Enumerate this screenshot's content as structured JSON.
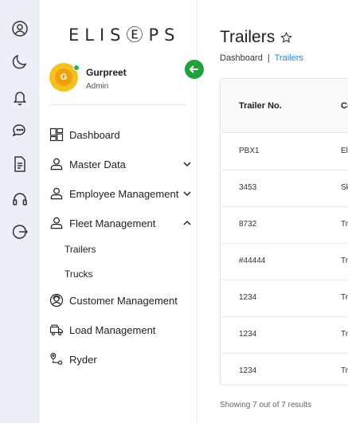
{
  "rail": {
    "icons": [
      "user-circle-icon",
      "moon-icon",
      "bell-icon",
      "chat-icon",
      "document-icon",
      "headset-icon",
      "logout-icon"
    ]
  },
  "sidebar": {
    "logo_text": "ELISⒺPS",
    "user": {
      "initial": "G",
      "name": "Gurpreet",
      "role": "Admin"
    },
    "items": [
      {
        "label": "Dashboard",
        "icon": "dashboard-icon"
      },
      {
        "label": "Master Data",
        "icon": "user-icon",
        "expanded": false
      },
      {
        "label": "Employee Management",
        "icon": "user-icon",
        "expanded": false
      },
      {
        "label": "Fleet Management",
        "icon": "user-icon",
        "expanded": true
      },
      {
        "label": "Customer Management",
        "icon": "customer-service-icon"
      },
      {
        "label": "Load Management",
        "icon": "truck-icon"
      },
      {
        "label": "Ryder",
        "icon": "route-icon"
      }
    ],
    "fleet_sub_items": [
      {
        "label": "Trailers"
      },
      {
        "label": "Trucks"
      }
    ]
  },
  "header": {
    "title": "Trailers",
    "breadcrumb": {
      "root": "Dashboard",
      "separator": "|",
      "current": "Trailers"
    }
  },
  "table": {
    "columns": [
      "Trailer No.",
      "Co"
    ],
    "rows": [
      {
        "trailer_no": "PBX1",
        "col2": "Ell"
      },
      {
        "trailer_no": "3453",
        "col2": "Sk"
      },
      {
        "trailer_no": "8732",
        "col2": "Tra"
      },
      {
        "trailer_no": "#44444",
        "col2": "Tra"
      },
      {
        "trailer_no": "1234",
        "col2": "Tra"
      },
      {
        "trailer_no": "1234",
        "col2": "Tra"
      },
      {
        "trailer_no": "1234",
        "col2": "Tra"
      }
    ]
  },
  "footer": {
    "showing_text": "Showing 7 out of 7 results"
  },
  "colors": {
    "accent": "#2a7fd4",
    "collapse_button": "#1fa23a",
    "rail_bg": "#eceef8",
    "avatar": "#f4c21a"
  }
}
